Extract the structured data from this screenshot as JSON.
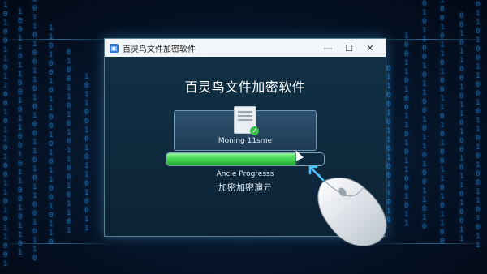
{
  "window": {
    "title": "百灵鸟文件加密软件",
    "controls": {
      "minimize": "—",
      "maximize": "☐",
      "close": "✕"
    }
  },
  "main": {
    "heading": "百灵鸟文件加密软件",
    "file_panel": {
      "label": "Moning 11sme",
      "icon": "document-check-icon"
    },
    "progress": {
      "value": 0.82,
      "caption": "Ancle Progresss"
    },
    "status": "加密加密演亓"
  },
  "colors": {
    "accent": "#4fc3ff",
    "progress": "#3fd34d",
    "window_bg": "#0c2235"
  }
}
